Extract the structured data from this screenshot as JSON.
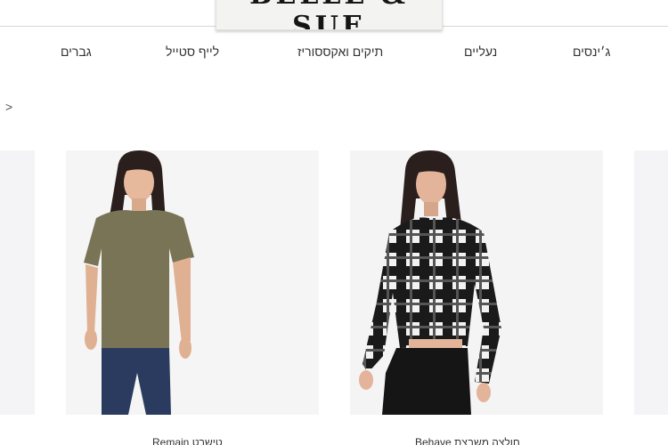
{
  "header": {
    "logo_text": "BELLE & SUE"
  },
  "nav": {
    "items": [
      {
        "label": "ג׳ינסים"
      },
      {
        "label": "נעליים"
      },
      {
        "label": "תיקים ואקססוריז"
      },
      {
        "label": "לייף סטייל"
      },
      {
        "label": "גברים"
      }
    ]
  },
  "carousel": {
    "prev_arrow": ">",
    "products": [
      {
        "title": "טישרט Remain",
        "image": "woman-olive-tshirt-photo"
      },
      {
        "title": "חולצה משבצת Behave",
        "image": "woman-plaid-shirt-photo"
      }
    ]
  },
  "colors": {
    "border": "#d6d6d6",
    "image_bg": "#f6f6f6",
    "text": "#333333"
  }
}
